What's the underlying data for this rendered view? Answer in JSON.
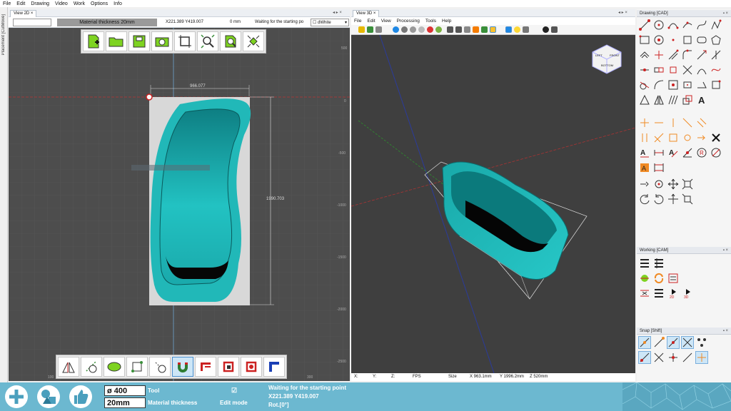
{
  "menubar": {
    "items": [
      "File",
      "Edit",
      "Drawing",
      "Video",
      "Work",
      "Options",
      "Info"
    ]
  },
  "sidestrip": {
    "label": "Placement [CutMove]"
  },
  "view2d": {
    "tab": "View 2D",
    "tab_close": "×",
    "controls": "◂ ▸ ×",
    "name_field": "",
    "material_thickness_label": "Material thickness 20mm",
    "coords": "X221.389 Y419.007",
    "depth": "0 mm",
    "status": "Waiting for the starting po",
    "color_select": "dWhite",
    "dim_width": "966.077",
    "dim_height": "1990.703",
    "ruler_ticks": [
      "500",
      "0",
      "-500",
      "-1000",
      "-1500",
      "-2000",
      "-2500"
    ],
    "bottom_ticks": [
      "100",
      "300"
    ]
  },
  "view3d": {
    "tab": "View 3D",
    "tab_close": "×",
    "controls": "◂ ▸ ×",
    "menu": [
      "File",
      "Edit",
      "View",
      "Processing",
      "Tools",
      "Help"
    ],
    "cube_faces": [
      "LEFT",
      "FRONT",
      "BOTTOM"
    ],
    "status": {
      "x": "X:",
      "y": "Y:",
      "z": "Z:",
      "fps": "FPS",
      "size": "Size",
      "size_x": "X 963.1mm",
      "size_y": "Y 1996.2mm",
      "size_z": "Z 520mm"
    }
  },
  "panels": {
    "drawing": {
      "title": "Drawing [CAD]",
      "controls": "▪ ×"
    },
    "working": {
      "title": "Working [CAM]",
      "controls": "▪ ×"
    },
    "snap": {
      "title": "Snap [Shift]",
      "controls": "▪ ×"
    }
  },
  "bottom": {
    "diameter": "ø 400",
    "thickness": "20mm",
    "tool_label": "Tool",
    "material_thickness_label": "Material thickness",
    "edit_mode_label": "Edit mode",
    "edit_mode_checkbox": "☑",
    "status_line1": "Waiting for the starting point",
    "status_line2": "X221.389 Y419.007",
    "status_line3": "Rot.[0°]"
  },
  "colors": {
    "accent": "#6cb8d0",
    "teal": "#1fb8b8",
    "canvas2d": "#4d4d4d",
    "canvas3d": "#3f3f3f"
  }
}
